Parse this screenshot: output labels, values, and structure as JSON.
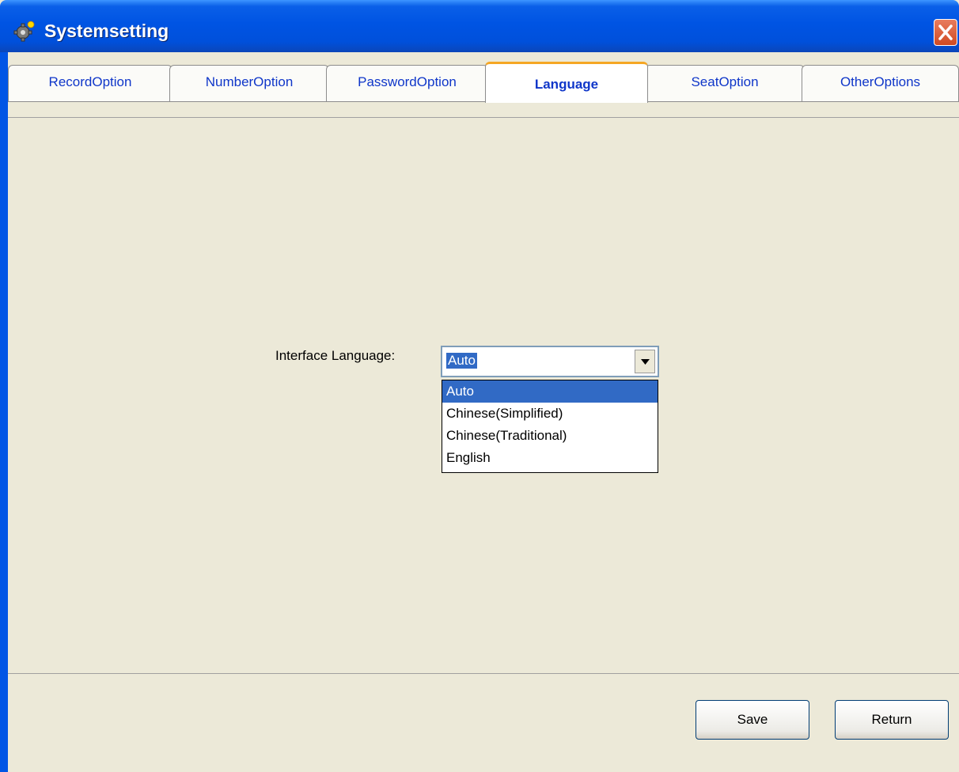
{
  "window": {
    "title": "Systemsetting"
  },
  "tabs": [
    {
      "label": "RecordOption"
    },
    {
      "label": "NumberOption"
    },
    {
      "label": "PasswordOption"
    },
    {
      "label": "Language",
      "active": true
    },
    {
      "label": "SeatOption"
    },
    {
      "label": "OtherOptions"
    }
  ],
  "language": {
    "label": "Interface Language:",
    "selected": "Auto",
    "options": [
      "Auto",
      "Chinese(Simplified)",
      "Chinese(Traditional)",
      "English"
    ]
  },
  "buttons": {
    "save": "Save",
    "return": "Return"
  },
  "colors": {
    "titlebar": "#0054E3",
    "tab_text": "#0F36C9",
    "selection": "#316AC5",
    "background": "#ECE9D8",
    "active_tab_accent": "#F5A623"
  }
}
